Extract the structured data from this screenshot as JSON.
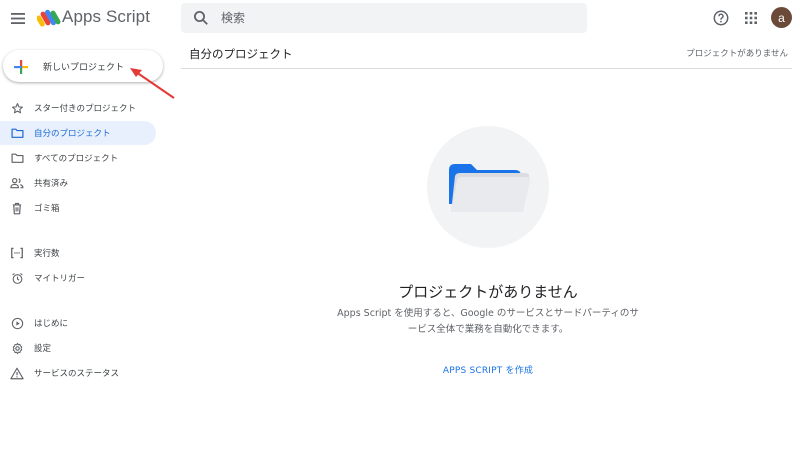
{
  "header": {
    "app_title": "Apps Script",
    "search_placeholder": "検索",
    "avatar_letter": "a"
  },
  "sidebar": {
    "new_project_label": "新しいプロジェクト",
    "items": [
      {
        "label": "スター付きのプロジェクト",
        "icon": "star-icon"
      },
      {
        "label": "自分のプロジェクト",
        "icon": "folder-icon",
        "active": true
      },
      {
        "label": "すべてのプロジェクト",
        "icon": "folder-icon"
      },
      {
        "label": "共有済み",
        "icon": "people-icon"
      },
      {
        "label": "ゴミ箱",
        "icon": "trash-icon"
      },
      {
        "label": "実行数",
        "icon": "executions-icon"
      },
      {
        "label": "マイトリガー",
        "icon": "alarm-icon"
      },
      {
        "label": "はじめに",
        "icon": "play-circle-icon"
      },
      {
        "label": "設定",
        "icon": "gear-icon"
      },
      {
        "label": "サービスのステータス",
        "icon": "warning-icon"
      }
    ]
  },
  "main": {
    "title": "自分のプロジェクト",
    "status": "プロジェクトがありません",
    "empty_title": "プロジェクトがありません",
    "empty_desc_line1": "Apps Script を使用すると、Google のサービスとサードパーティのサ",
    "empty_desc_line2": "ービス全体で業務を自動化できます。",
    "create_link": "APPS SCRIPT を作成"
  },
  "colors": {
    "accent": "#1a73e8",
    "active_bg": "#e8f0fe",
    "annotation_arrow": "#e53935",
    "folder_blue": "#1a73e8"
  }
}
